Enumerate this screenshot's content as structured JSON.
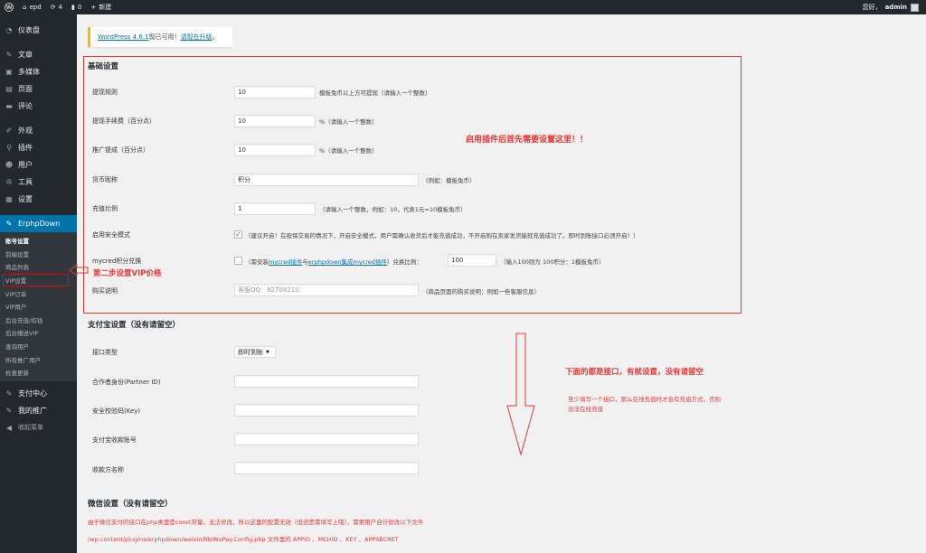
{
  "adminbar": {
    "site_name": "epd",
    "updates_count": "4",
    "comments_count": "0",
    "new_label": "新建",
    "greeting": "您好，",
    "username": "admin"
  },
  "sidebar": {
    "items": [
      {
        "label": "仪表盘",
        "icon": "dashboard-icon"
      },
      {
        "label": "文章",
        "icon": "pin-icon"
      },
      {
        "label": "多媒体",
        "icon": "media-icon"
      },
      {
        "label": "页面",
        "icon": "page-icon"
      },
      {
        "label": "评论",
        "icon": "comment-icon"
      },
      {
        "label": "外观",
        "icon": "brush-icon"
      },
      {
        "label": "插件",
        "icon": "plugin-icon"
      },
      {
        "label": "用户",
        "icon": "user-icon"
      },
      {
        "label": "工具",
        "icon": "wrench-icon"
      },
      {
        "label": "设置",
        "icon": "settings-icon"
      }
    ],
    "active": {
      "label": "ErphpDown",
      "icon": "erphpdown-icon"
    },
    "submenu": [
      "账号设置",
      "前端设置",
      "商品列表",
      "VIP设置",
      "VIP订单",
      "VIP用户",
      "后台充值/扣钱",
      "后台赠送VIP",
      "查询用户",
      "所有推广用户",
      "检查更新"
    ],
    "after": [
      {
        "label": "支付中心",
        "icon": "payment-icon"
      },
      {
        "label": "我的推广",
        "icon": "promotion-icon"
      },
      {
        "label": "收起菜单",
        "icon": "collapse-icon"
      }
    ]
  },
  "notice": {
    "version_link": "WordPress 4.6.1",
    "text": "现已可用！",
    "upgrade_link": "请现在升级",
    "tail": "。"
  },
  "basic": {
    "title": "基础设置",
    "withdraw_rule": {
      "label": "提现规则",
      "value": "10",
      "desc": "模板兔币以上方可提现（请输入一个整数）"
    },
    "withdraw_fee": {
      "label": "提现手续费（百分点）",
      "value": "10",
      "desc": "%（请输入一个整数）"
    },
    "promo_commission": {
      "label": "推广提成（百分点）",
      "value": "10",
      "desc": "%（请输入一个整数）"
    },
    "currency_name": {
      "label": "货币昵称",
      "value": "积分",
      "desc": "（例如：模板兔币）"
    },
    "recharge_ratio": {
      "label": "充值比例",
      "value": "1",
      "desc": "（请输入一个整数，例如：10，代表1元=10模板兔币）"
    },
    "safe_mode": {
      "label": "启用安全模式",
      "checked": "✓",
      "desc": "（建议开启！在担保交易的情况下，开启安全模式，用户需确认收货后才能充值成功，不开启则在卖家发货能就充值成功了。即时到账接口必须开启！）"
    },
    "mycred": {
      "label": "mycred积分兑换",
      "desc_pre": "（需安装",
      "link1": "mycred插件",
      "and": "与",
      "link2": "erphpdown集成mycred插件",
      "desc_post": "）兑换比例：",
      "ratio_value": "100",
      "ratio_desc": "（输入100则为 100积分：1模板兔币）"
    },
    "purchase_note": {
      "label": "购买说明",
      "placeholder": "客服QQ：82708210",
      "desc": "（商品页面的购买说明：例如一些客服信息）"
    }
  },
  "alipay": {
    "title": "支付宝设置（没有请留空）",
    "interface_type": {
      "label": "接口类型",
      "value": "即时到账"
    },
    "partner_id": {
      "label": "合作者身份(Partner ID)"
    },
    "security_key": {
      "label": "安全校验码(Key)"
    },
    "account": {
      "label": "支付宝收款账号"
    },
    "payee_name": {
      "label": "收款方名称"
    }
  },
  "wechat": {
    "title": "微信设置（没有请留空）"
  },
  "annotations": {
    "step1": "启用插件后首先需要设置这里！！",
    "step2": "第二步设置VIP价格",
    "interfaces": "下面的都是接口，有就设置，没有请留空",
    "at_least": "至少填写一个接口，那么在线充值时才会有充值方式，否则没法在线充值",
    "wechat_note": "由于微信支付的接口在php类里是const常量，无法修改，所以这里的配置无效（但还是需填写上哦），需要用户自行修改以下文件",
    "wechat_path": "/wp-content/plugins/erphpdown/weixin/lib/WxPay.Config.php 文件里的 APPID 、MCHID 、KEY 、APPSECRET"
  },
  "colors": {
    "admin_bg": "#23282d",
    "accent": "#0073aa",
    "annotation_red": "#e53935",
    "notice_border": "#ffb900"
  }
}
